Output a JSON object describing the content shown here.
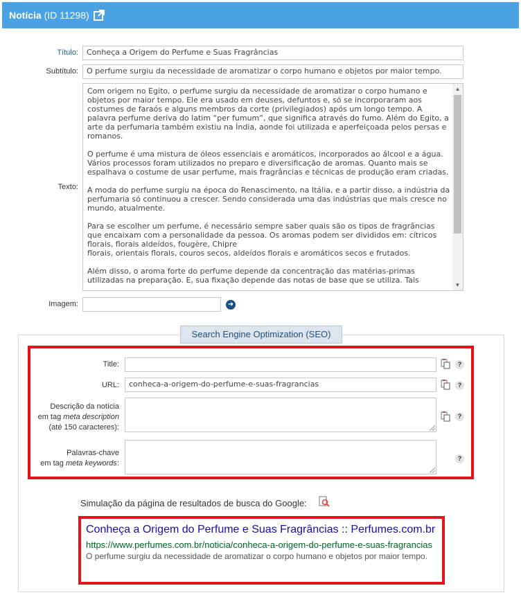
{
  "header": {
    "title": "Notícia",
    "id_label": "(ID 11298)",
    "link_icon": "external-link-icon"
  },
  "form": {
    "titulo_label": "Título:",
    "titulo_value": "Conheça a Origem do Perfume e Suas Fragrâncias",
    "subtitulo_label": "Subtítulo:",
    "subtitulo_value": "O perfume surgiu da necessidade de aromatizar o corpo humano e objetos por maior tempo.",
    "texto_label": "Texto:",
    "texto_value": "Com origem no Egito, o perfume surgiu da necessidade de aromatizar o corpo humano e objetos por maior tempo. Ele era usado em deuses, defuntos e, só se incorporaram aos costumes de faraós e alguns membros da corte (privilegiados) após um longo tempo. A palavra perfume deriva do latim “per fumum”, que significa através do fumo. Além do Egito, a arte da perfumaria também existiu na Índia, aonde foi utilizada e aperfeiçoada pelos persas e romanos.\n\nO perfume é uma mistura de óleos essenciais e aromáticos, incorporados ao álcool e a água. Vários processos foram utilizados no preparo e diversificação de aromas. Quanto mais se espalhava o costume de usar perfume, mais fragrâncias e técnicas de produção eram criadas.\n\nA moda do perfume surgiu na época do Renascimento, na Itália, e a partir disso, a indústria da perfumaria só continuou a crescer. Sendo considerada uma das indústrias que mais cresce no mundo, atualmente.\n\nPara se escolher um perfume, é necessário sempre saber quais são os tipos de fragrâncias que encaixam com a personalidade da pessoa. Os aromas podem ser divididos em: cítricos florais, florais aldeídos, fougère, Chipre\nflorais, orientais florais, couros secos, aldeídos florais e aromáticos secos e frutados.\n\nAlém disso, o aroma forte do perfume depende da concentração das matérias-primas utilizadas na preparação. E, sua fixação depende das notas de base que se utiliza. Tais",
    "imagem_label": "Imagem:",
    "imagem_value": ""
  },
  "seo": {
    "tab_label": "Search Engine Optimization (SEO)",
    "title_label": "Title:",
    "title_value": "",
    "url_label": "URL:",
    "url_value": "conheca-a-origem-do-perfume-e-suas-fragrancias",
    "desc_label_1": "Descrição da notícia",
    "desc_label_2a": "em tag ",
    "desc_label_2b": "meta description",
    "desc_label_3": "(até 150 caracteres):",
    "kw_label_1": "Palavras-chave",
    "kw_label_2a": "em tag ",
    "kw_label_2b": "meta keywords",
    "kw_label_2c": ":",
    "help_glyph": "?"
  },
  "simulation": {
    "label": "Simulação da página de resultados de busca do Google:",
    "g_title": "Conheça a Origem do Perfume e Suas Fragrâncias :: Perfumes.com.br",
    "g_url": "https://www.perfumes.com.br/noticia/conheca-a-origem-do-perfume-e-suas-fragrancias",
    "g_desc": "O perfume surgiu da necessidade de aromatizar o corpo humano e objetos por maior tempo."
  },
  "colors": {
    "header": "#4aa1e3",
    "highlight": "#e3131b",
    "google_title": "#1a0dab",
    "google_url": "#006621"
  }
}
